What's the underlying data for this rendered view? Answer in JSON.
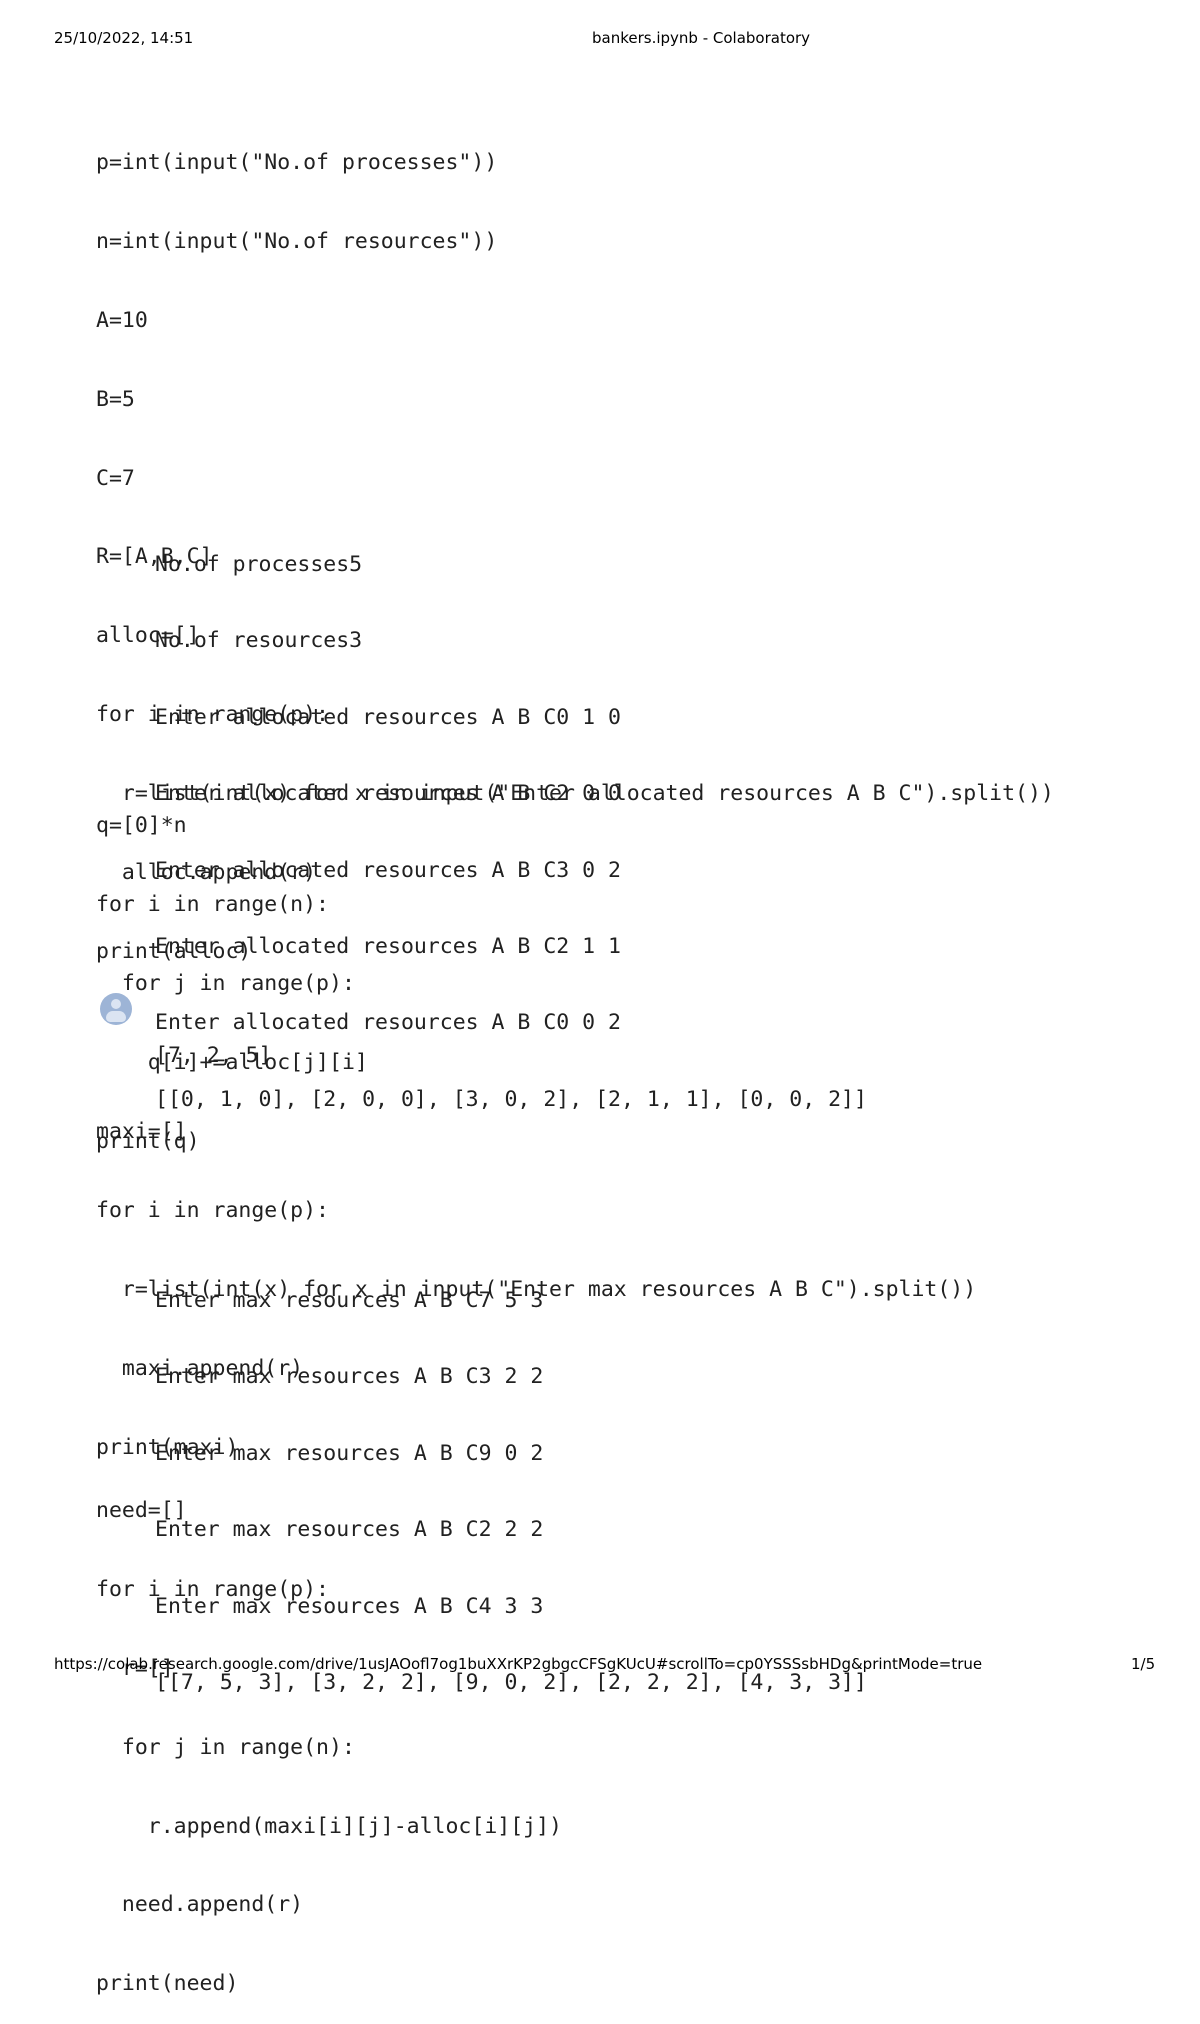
{
  "print_header": {
    "datetime": "25/10/2022, 14:51",
    "title": "bankers.ipynb - Colaboratory"
  },
  "print_footer": {
    "url": "https://colab.research.google.com/drive/1usJAOofl7og1buXXrKP2gbgcCFSgKUcU#scrollTo=cp0YSSSsbHDg&printMode=true",
    "page": "1/5"
  },
  "cells": [
    {
      "code": [
        "p=int(input(\"No.of processes\"))",
        "n=int(input(\"No.of resources\"))",
        "A=10",
        "B=5",
        "C=7",
        "R=[A,B,C]",
        "alloc=[]",
        "for i in range(p):",
        "  r=list(int(x) for x in input(\"Enter allocated resources A B C\").split())",
        "  alloc.append(r)",
        "print(alloc)"
      ],
      "output": [
        "No.of processes5",
        "No.of resources3",
        "Enter allocated resources A B C0 1 0",
        "Enter allocated resources A B C2 0 0",
        "Enter allocated resources A B C3 0 2",
        "Enter allocated resources A B C2 1 1",
        "Enter allocated resources A B C0 0 2",
        "[[0, 1, 0], [2, 0, 0], [3, 0, 2], [2, 1, 1], [0, 0, 2]]"
      ]
    },
    {
      "code": [
        "q=[0]*n",
        "for i in range(n):",
        "  for j in range(p):",
        "    q[i]+=alloc[j][i]",
        "print(q)"
      ],
      "output": [
        "[7, 2, 5]"
      ]
    },
    {
      "code": [
        "maxi=[]",
        "for i in range(p):",
        "  r=list(int(x) for x in input(\"Enter max resources A B C\").split())",
        "  maxi.append(r)",
        "print(maxi)"
      ],
      "output": [
        "Enter max resources A B C7 5 3",
        "Enter max resources A B C3 2 2",
        "Enter max resources A B C9 0 2",
        "Enter max resources A B C2 2 2",
        "Enter max resources A B C4 3 3",
        "[[7, 5, 3], [3, 2, 2], [9, 0, 2], [2, 2, 2], [4, 3, 3]]"
      ]
    },
    {
      "code": [
        "need=[]",
        "for i in range(p):",
        "  r=[]",
        "  for j in range(n):",
        "    r.append(maxi[i][j]-alloc[i][j])",
        "  need.append(r)",
        "print(need)"
      ],
      "output": []
    }
  ],
  "icons": {
    "output_avatar": "user-avatar-icon"
  }
}
